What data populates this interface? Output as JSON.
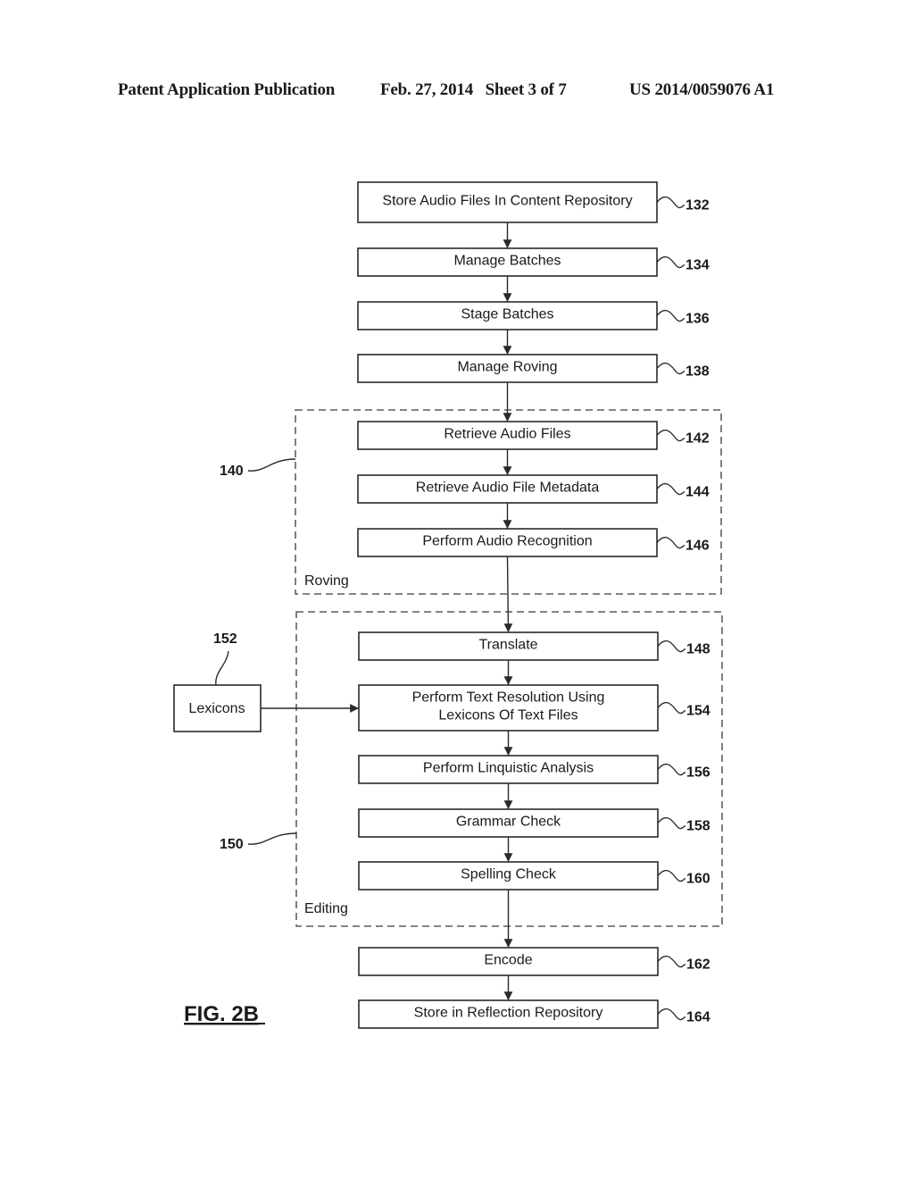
{
  "header": {
    "publication": "Patent Application Publication",
    "date_sheet": "Feb. 27, 2014   Sheet 3 of 7",
    "number": "US 2014/0059076 A1"
  },
  "figure_label": "FIG. 2B",
  "steps": [
    {
      "id": "s132",
      "lines": [
        "Store Audio Files In Content Repository"
      ],
      "ref": "132"
    },
    {
      "id": "s134",
      "lines": [
        "Manage Batches"
      ],
      "ref": "134"
    },
    {
      "id": "s136",
      "lines": [
        "Stage Batches"
      ],
      "ref": "136"
    },
    {
      "id": "s138",
      "lines": [
        "Manage Roving"
      ],
      "ref": "138"
    },
    {
      "id": "s142",
      "lines": [
        "Retrieve Audio Files"
      ],
      "ref": "142"
    },
    {
      "id": "s144",
      "lines": [
        "Retrieve Audio File Metadata"
      ],
      "ref": "144"
    },
    {
      "id": "s146",
      "lines": [
        "Perform Audio Recognition"
      ],
      "ref": "146"
    },
    {
      "id": "s148",
      "lines": [
        "Translate"
      ],
      "ref": "148"
    },
    {
      "id": "s154",
      "lines": [
        "Perform Text Resolution Using",
        "Lexicons Of Text Files"
      ],
      "ref": "154"
    },
    {
      "id": "s156",
      "lines": [
        "Perform Linquistic Analysis"
      ],
      "ref": "156"
    },
    {
      "id": "s158",
      "lines": [
        "Grammar Check"
      ],
      "ref": "158"
    },
    {
      "id": "s160",
      "lines": [
        "Spelling Check"
      ],
      "ref": "160"
    },
    {
      "id": "s162",
      "lines": [
        "Encode"
      ],
      "ref": "162"
    },
    {
      "id": "s164",
      "lines": [
        "Store in Reflection Repository"
      ],
      "ref": "164"
    }
  ],
  "groups": [
    {
      "id": "roving",
      "label": "Roving",
      "ref": "140"
    },
    {
      "id": "editing",
      "label": "Editing",
      "ref": "150"
    }
  ],
  "lexicons": {
    "label": "Lexicons",
    "ref": "152"
  }
}
